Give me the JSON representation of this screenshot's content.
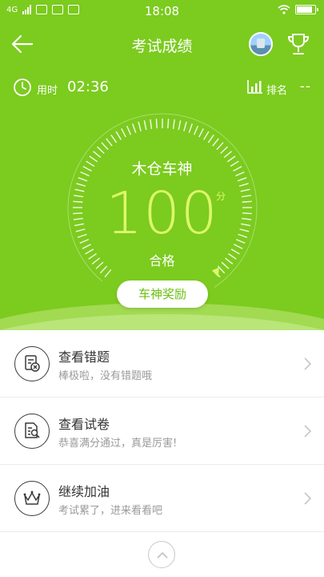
{
  "status_bar": {
    "network": "4G",
    "time": "18:08"
  },
  "header": {
    "title": "考试成绩"
  },
  "stats": {
    "time_label": "用时",
    "time_value": "02:36",
    "rank_label": "排名",
    "rank_value": "--"
  },
  "result": {
    "user_name": "木仓车神",
    "score": "100",
    "score_unit": "分",
    "verdict": "合格",
    "reward_button": "车神奖励",
    "score_ratio": 1.0
  },
  "actions": [
    {
      "title": "查看错题",
      "subtitle": "棒极啦，没有错题哦",
      "icon": "wrong-questions-icon"
    },
    {
      "title": "查看试卷",
      "subtitle": "恭喜满分通过，真是厉害!",
      "icon": "exam-paper-icon"
    },
    {
      "title": "继续加油",
      "subtitle": "考试累了，进来看看吧",
      "icon": "crown-icon"
    }
  ],
  "colors": {
    "accent": "#7ccb1f",
    "score": "#dcf86a",
    "reward_text": "#6bbf12"
  }
}
